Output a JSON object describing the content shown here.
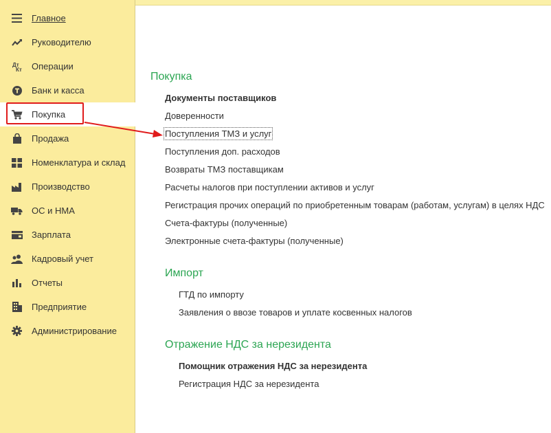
{
  "sidebar": {
    "items": [
      {
        "label": "Главное",
        "icon": "menu-icon"
      },
      {
        "label": "Руководителю",
        "icon": "trend-icon"
      },
      {
        "label": "Операции",
        "icon": "debit-credit-icon"
      },
      {
        "label": "Банк и касса",
        "icon": "bank-icon"
      },
      {
        "label": "Покупка",
        "icon": "cart-icon"
      },
      {
        "label": "Продажа",
        "icon": "shopping-bag-icon"
      },
      {
        "label": "Номенклатура и склад",
        "icon": "grid-icon"
      },
      {
        "label": "Производство",
        "icon": "factory-icon"
      },
      {
        "label": "ОС и НМА",
        "icon": "truck-icon"
      },
      {
        "label": "Зарплата",
        "icon": "wallet-icon"
      },
      {
        "label": "Кадровый учет",
        "icon": "people-icon"
      },
      {
        "label": "Отчеты",
        "icon": "bar-chart-icon"
      },
      {
        "label": "Предприятие",
        "icon": "building-icon"
      },
      {
        "label": "Администрирование",
        "icon": "gear-icon"
      }
    ]
  },
  "main": {
    "purchase": {
      "title": "Покупка",
      "links": [
        "Документы поставщиков",
        "Доверенности",
        "Поступления ТМЗ и услуг",
        "Поступления доп. расходов",
        "Возвраты ТМЗ поставщикам",
        "Расчеты налогов при поступлении активов и услуг",
        "Регистрация прочих операций по приобретенным товарам (работам, услугам) в целях НДС",
        "Счета-фактуры (полученные)",
        "Электронные счета-фактуры (полученные)"
      ]
    },
    "import": {
      "title": "Импорт",
      "links": [
        "ГТД по импорту",
        "Заявления о ввозе товаров и уплате косвенных налогов"
      ]
    },
    "vat": {
      "title": "Отражение НДС за нерезидента",
      "links": [
        "Помощник отражения НДС за нерезидента",
        "Регистрация НДС за нерезидента"
      ]
    }
  },
  "colors": {
    "sidebar_bg": "#fbec9d",
    "section_title": "#2ba552",
    "annotation_red": "#e01b1b"
  }
}
